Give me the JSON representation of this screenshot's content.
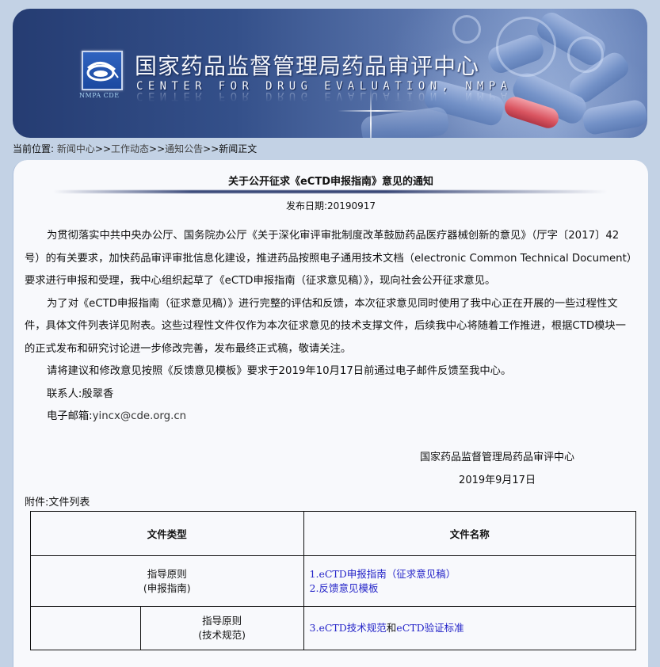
{
  "banner": {
    "title_cn": "国家药品监督管理局药品审评中心",
    "title_en": "CENTER FOR DRUG EVALUATION, NMPA",
    "logo_caption": "NMPA CDE"
  },
  "breadcrumb": {
    "prefix": "当前位置:",
    "items": [
      "新闻中心",
      "工作动态",
      "通知公告",
      "新闻正文"
    ],
    "separator": ">>"
  },
  "article": {
    "title": "关于公开征求《eCTD申报指南》意见的通知",
    "pubdate_label": "发布日期:",
    "pubdate_value": "20190917",
    "paragraphs": [
      "为贯彻落实中共中央办公厅、国务院办公厅《关于深化审评审批制度改革鼓励药品医疗器械创新的意见》（厅字〔2017〕42号）的有关要求，加快药品审评审批信息化建设，推进药品按照电子通用技术文档（electronic Common Technical Document）要求进行申报和受理，我中心组织起草了《eCTD申报指南（征求意见稿）》，现向社会公开征求意见。",
      "为了对《eCTD申报指南（征求意见稿）》进行完整的评估和反馈，本次征求意见同时使用了我中心正在开展的一些过程性文件，具体文件列表详见附表。这些过程性文件仅作为本次征求意见的技术支撑文件，后续我中心将随着工作推进，根据CTD模块一的正式发布和研究讨论进一步修改完善，发布最终正式稿，敬请关注。",
      "请将建议和修改意见按照《反馈意见模板》要求于2019年10月17日前通过电子邮件反馈至我中心。"
    ],
    "contact_label": "联系人:",
    "contact_name": "殷翠香",
    "email_label": "电子邮箱:",
    "email_value": "yincx@cde.org.cn",
    "signature_org": "国家药品监督管理局药品审评中心",
    "signature_date": "2019年9月17日",
    "attachment_label": "附件:文件列表"
  },
  "file_table": {
    "headers": [
      "文件类型",
      "文件名称"
    ],
    "rows": [
      {
        "type_line1": "指导原则",
        "type_line2": "(申报指南)",
        "files": [
          {
            "num": "1.",
            "label": "eCTD申报指南（征求意见稿）"
          },
          {
            "num": "2.",
            "label": "反馈意见模板"
          }
        ]
      },
      {
        "type_line1": "指导原则",
        "type_line2": "(技术规范)",
        "files": [
          {
            "num": "3.",
            "label_a": "eCTD技术规范",
            "joiner": "和",
            "label_b": "eCTD验证标准"
          }
        ]
      }
    ]
  },
  "colors": {
    "page_bg": "#c3d2e5",
    "panel_bg": "#f8f9fc",
    "link": "#2424c8",
    "banner_dark": "#253c72"
  }
}
